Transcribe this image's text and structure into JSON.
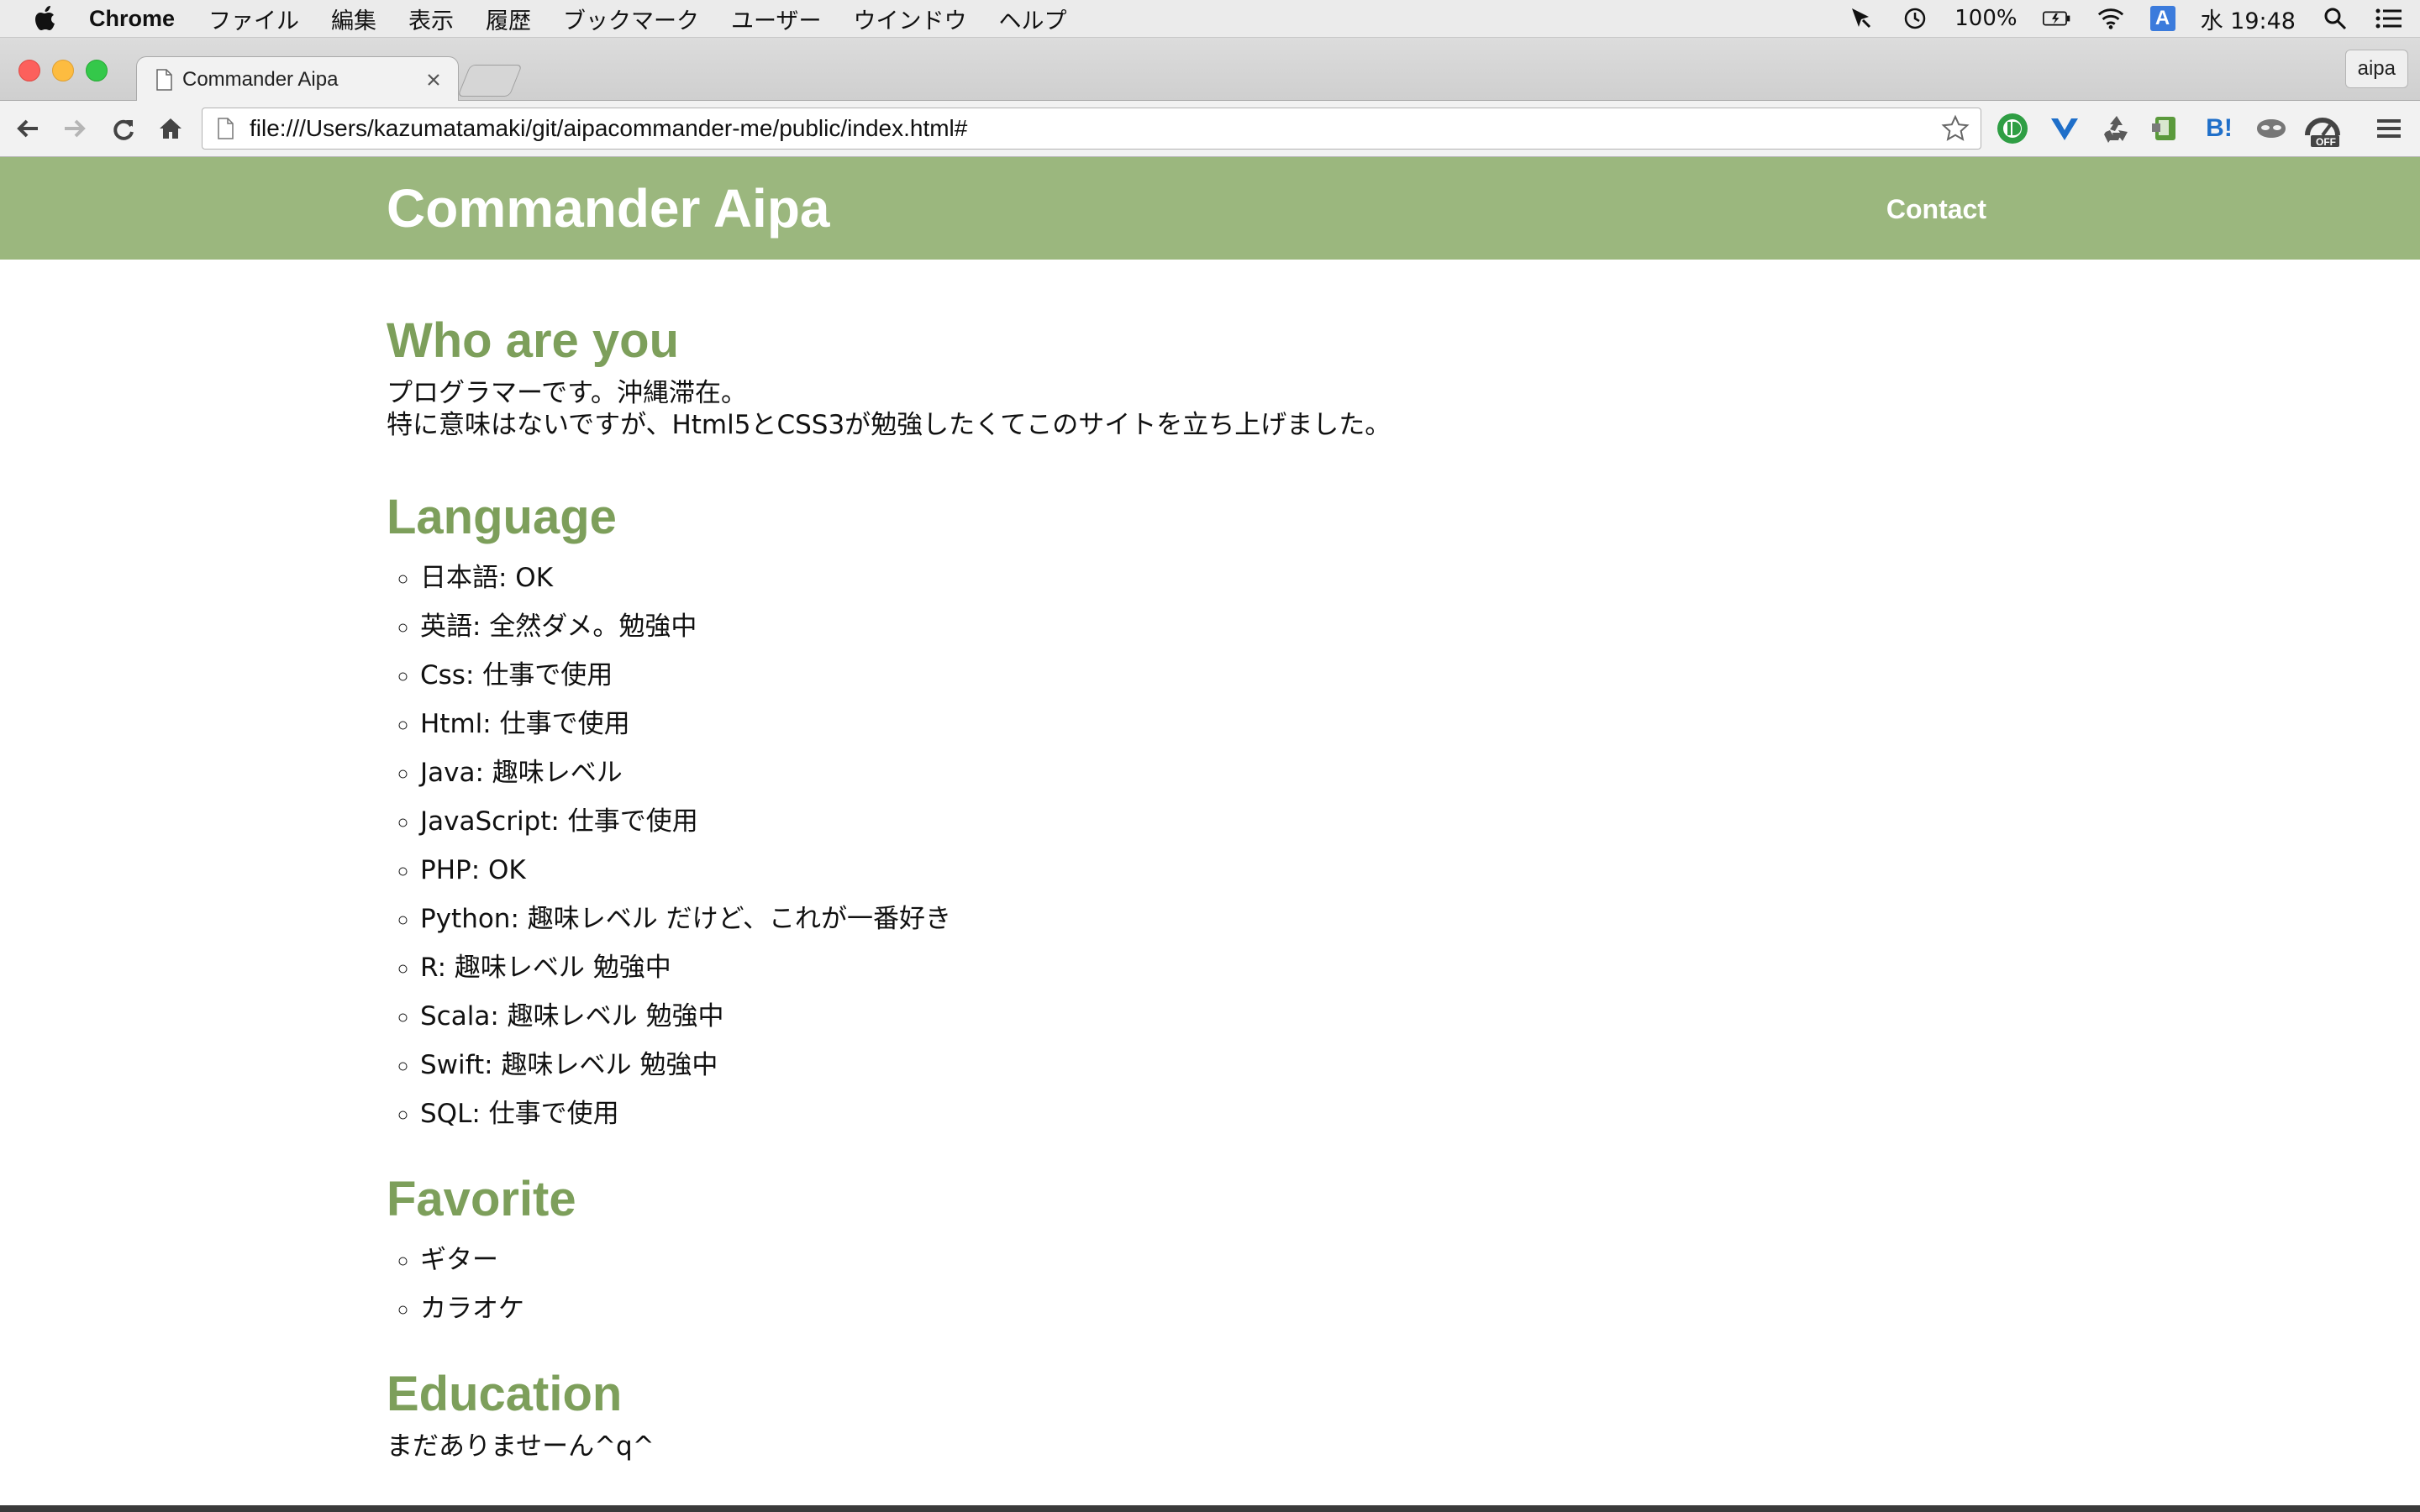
{
  "menubar": {
    "app_name": "Chrome",
    "items": [
      "ファイル",
      "編集",
      "表示",
      "履歴",
      "ブックマーク",
      "ユーザー",
      "ウインドウ",
      "ヘルプ"
    ],
    "battery": "100%",
    "input_method": "A",
    "clock": "水 19:48"
  },
  "browser": {
    "tab_title": "Commander Aipa",
    "profile": "aipa",
    "url": "file:///Users/kazumatamaki/git/aipacommander-me/public/index.html#",
    "extensions": [
      "ID",
      "Y",
      "♻",
      "B!",
      "OFF"
    ]
  },
  "site": {
    "title": "Commander Aipa",
    "nav": {
      "contact": "Contact"
    },
    "colors": {
      "header": "#9bb77e",
      "heading": "#7d9f5b"
    }
  },
  "sections": {
    "who": {
      "heading": "Who are you",
      "lines": [
        "プログラマーです。沖縄滞在。",
        "特に意味はないですが、Html5とCSS3が勉強したくてこのサイトを立ち上げました。"
      ]
    },
    "language": {
      "heading": "Language",
      "items": [
        "日本語: OK",
        "英語: 全然ダメ。勉強中",
        "Css: 仕事で使用",
        "Html: 仕事で使用",
        "Java: 趣味レベル",
        "JavaScript: 仕事で使用",
        "PHP: OK",
        "Python: 趣味レベル だけど、これが一番好き",
        "R: 趣味レベル 勉強中",
        "Scala: 趣味レベル 勉強中",
        "Swift: 趣味レベル 勉強中",
        "SQL: 仕事で使用"
      ]
    },
    "favorite": {
      "heading": "Favorite",
      "items": [
        "ギター",
        "カラオケ"
      ]
    },
    "education": {
      "heading": "Education",
      "text": "まだありませーん^q^"
    }
  }
}
